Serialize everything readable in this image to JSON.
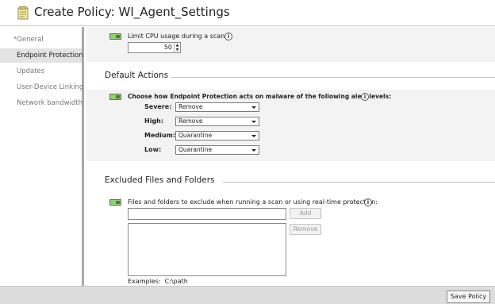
{
  "title": "Create Policy: WI_Agent_Settings",
  "sidebar": {
    "required_marker": "*",
    "items": [
      {
        "label": "General"
      },
      {
        "label": "Endpoint Protection"
      },
      {
        "label": "Updates"
      },
      {
        "label": "User-Device Linking"
      },
      {
        "label": "Network bandwidth"
      }
    ]
  },
  "cpu": {
    "label": "Limit CPU usage during a scan:",
    "value": "50"
  },
  "default_actions": {
    "heading": "Default Actions",
    "prompt": "Choose how Endpoint Protection acts on malware of the following alert levels:",
    "levels": [
      {
        "label": "Severe:",
        "value": "Remove"
      },
      {
        "label": "High:",
        "value": "Remove"
      },
      {
        "label": "Medium:",
        "value": "Quarantine"
      },
      {
        "label": "Low:",
        "value": "Quarantine"
      }
    ]
  },
  "excluded": {
    "heading": "Excluded Files and Folders",
    "label": "Files and folders to exclude when running a scan or using real-time protection:",
    "input_value": "",
    "add_label": "Add",
    "remove_label": "Remove",
    "examples_label": "Examples:",
    "examples_value": "C:\\path"
  },
  "info_glyph": "i",
  "save_label": "Save Policy"
}
